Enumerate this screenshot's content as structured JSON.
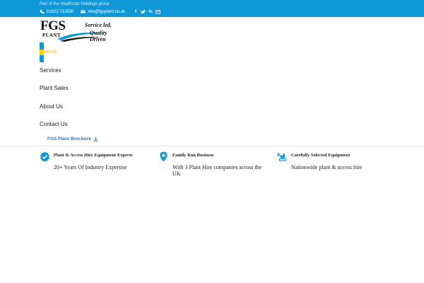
{
  "topbar": {
    "group_text": "Part of the Heathcote Holdings group",
    "phone": "01622 713550",
    "email": "info@fgsplant.co.uk",
    "social_icons": [
      "facebook-icon",
      "twitter-icon",
      "linkedin-icon",
      "mail-icon"
    ],
    "background": "#0f98d8"
  },
  "logo": {
    "name": "FGS",
    "sub": "PLANT",
    "tagline_1": "Service led,",
    "tagline_2": "Quality Driven"
  },
  "nav": {
    "home": "Home",
    "services": "Services",
    "plant_sales": "Plant Sales",
    "about": "About Us",
    "contact": "Contact Us",
    "brochure": "FGS Plant Brochure"
  },
  "features": [
    {
      "icon": "check-circle-icon",
      "title": "Plant & Access Hire Equipment Experts",
      "text": "20+ Years Of Industry Expertise"
    },
    {
      "icon": "location-pin-icon",
      "title": "Family Run Business",
      "text": "With 3 Plant Hire companies across the UK"
    },
    {
      "icon": "excavator-icon",
      "title": "Carefully Selected Equipment",
      "text": "Nationwide plant & access hire"
    }
  ],
  "colors": {
    "accent": "#0f98d8",
    "highlight": "#ffd400",
    "link": "#0f7fbd"
  }
}
